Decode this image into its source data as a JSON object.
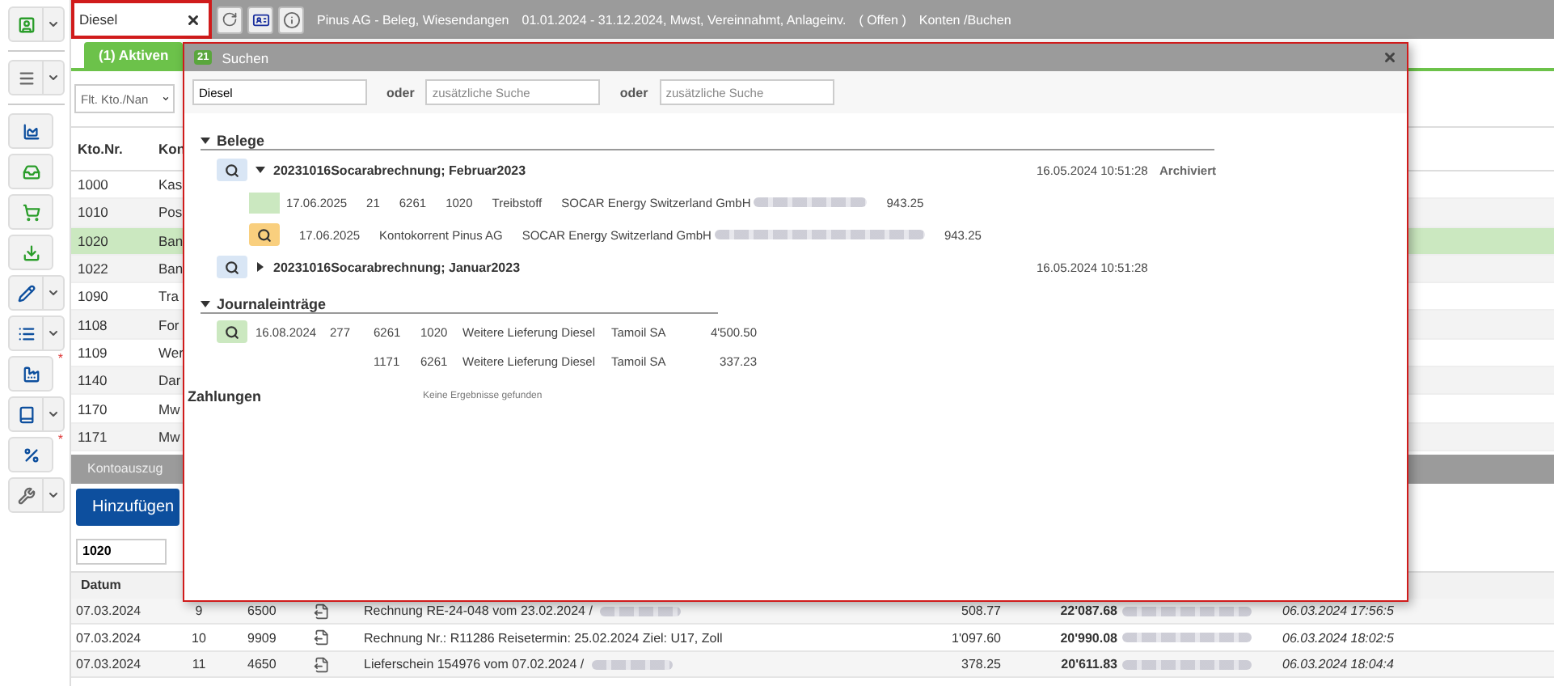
{
  "topbar": {
    "search": {
      "value": "Diesel"
    },
    "title": "Pinus AG - Beleg, Wiesendangen",
    "period": "01.01.2024 - 31.12.2024, Mwst, Vereinnahmt, Anlageinv.",
    "status": "( Offen )",
    "section": "Konten /Buchen"
  },
  "sidebar": [
    {
      "buttons": [
        {
          "caret": true
        }
      ]
    },
    {
      "buttons": [
        {
          "caret": true
        }
      ]
    },
    {
      "buttons": [
        {
          "caret": false
        },
        {
          "caret": false
        },
        {
          "caret": false
        },
        {
          "caret": false
        },
        {
          "caret": true
        },
        {
          "caret": true
        },
        {
          "caret": false,
          "note": "*"
        },
        {
          "caret": true
        },
        {
          "caret": false,
          "note": "*"
        },
        {
          "caret": true
        }
      ]
    }
  ],
  "tabs": [
    {
      "label": "(1) Aktiven",
      "selected": true
    }
  ],
  "filter": {
    "placeholder": "Flt. Kto./Nan"
  },
  "accounts": {
    "columns": [
      "Kto.Nr.",
      "Kon"
    ],
    "rows": [
      {
        "nr": "1000",
        "name": "Kas",
        "selected": false
      },
      {
        "nr": "1010",
        "name": "Pos",
        "selected": false
      },
      {
        "nr": "1020",
        "name": "Ban",
        "selected": true
      },
      {
        "nr": "1022",
        "name": "Ban",
        "selected": false
      },
      {
        "nr": "1090",
        "name": "Tra",
        "selected": false
      },
      {
        "nr": "1108",
        "name": "For",
        "selected": false
      },
      {
        "nr": "1109",
        "name": "Wer",
        "selected": false
      },
      {
        "nr": "1140",
        "name": "Dar",
        "selected": false
      },
      {
        "nr": "1170",
        "name": "Mw",
        "selected": false
      },
      {
        "nr": "1171",
        "name": "Mw",
        "selected": false
      }
    ]
  },
  "statement": {
    "title": "Kontoauszug",
    "add_button": "Hinzufügen",
    "account": "1020",
    "columns": [
      "Datum"
    ],
    "rows": [
      {
        "date": "07.03.2024",
        "no": "9",
        "account": "6500",
        "text": "Rechnung RE-24-048 vom 23.02.2024 /",
        "redacted": true,
        "amount": "508.77",
        "balance": "22'087.68",
        "timestamp": "06.03.2024 17:56:5"
      },
      {
        "date": "07.03.2024",
        "no": "10",
        "account": "9909",
        "text": "Rechnung Nr.: R11286 Reisetermin: 25.02.2024 Ziel: U17, Zoll",
        "redacted": false,
        "amount": "1'097.60",
        "balance": "20'990.08",
        "timestamp": "06.03.2024 18:02:5"
      },
      {
        "date": "07.03.2024",
        "no": "11",
        "account": "4650",
        "text": "Lieferschein 154976 vom 07.02.2024 /",
        "redacted": true,
        "amount": "378.25",
        "balance": "20'611.83",
        "timestamp": "06.03.2024 18:04:4"
      }
    ]
  },
  "dialog": {
    "badge": "21",
    "title": "Suchen",
    "search": [
      {
        "value": "Diesel"
      },
      {
        "connector": "oder",
        "placeholder": "zusätzliche Suche"
      },
      {
        "connector": "oder",
        "placeholder": "zusätzliche Suche"
      }
    ],
    "sections": [
      {
        "kind": "documents",
        "title": "Belege",
        "expanded": true,
        "groups": [
          {
            "title": "20231016Socarabrechnung; Februar2023",
            "expanded": true,
            "timestamp": "16.05.2024 10:51:28",
            "status": "Archiviert",
            "lines": [
              {
                "kind": "booking",
                "cells": [
                  "17.06.2025",
                  "21",
                  "6261",
                  "1020",
                  "Treibstoff",
                  "SOCAR Energy Switzerland GmbH"
                ],
                "redacted": true,
                "amount": "943.25"
              },
              {
                "kind": "document",
                "cells": [
                  "17.06.2025",
                  "Kontokorrent Pinus AG",
                  "SOCAR Energy Switzerland GmbH"
                ],
                "redacted": true,
                "amount": "943.25"
              }
            ]
          },
          {
            "title": "20231016Socarabrechnung; Januar2023",
            "expanded": false,
            "timestamp": "16.05.2024 10:51:28"
          }
        ]
      },
      {
        "kind": "journal",
        "title": "Journaleinträge",
        "expanded": true,
        "rows": [
          {
            "button": true,
            "cells": [
              "16.08.2024",
              "277",
              "6261",
              "1020",
              "Weitere Lieferung Diesel",
              "Tamoil SA",
              "4'500.50"
            ]
          },
          {
            "button": false,
            "cells": [
              "",
              "",
              "1171",
              "6261",
              "Weitere Lieferung Diesel",
              "Tamoil SA",
              "337.23"
            ]
          }
        ]
      },
      {
        "kind": "empty",
        "title": "Zahlungen",
        "message": "Keine Ergebnisse gefunden"
      }
    ]
  }
}
